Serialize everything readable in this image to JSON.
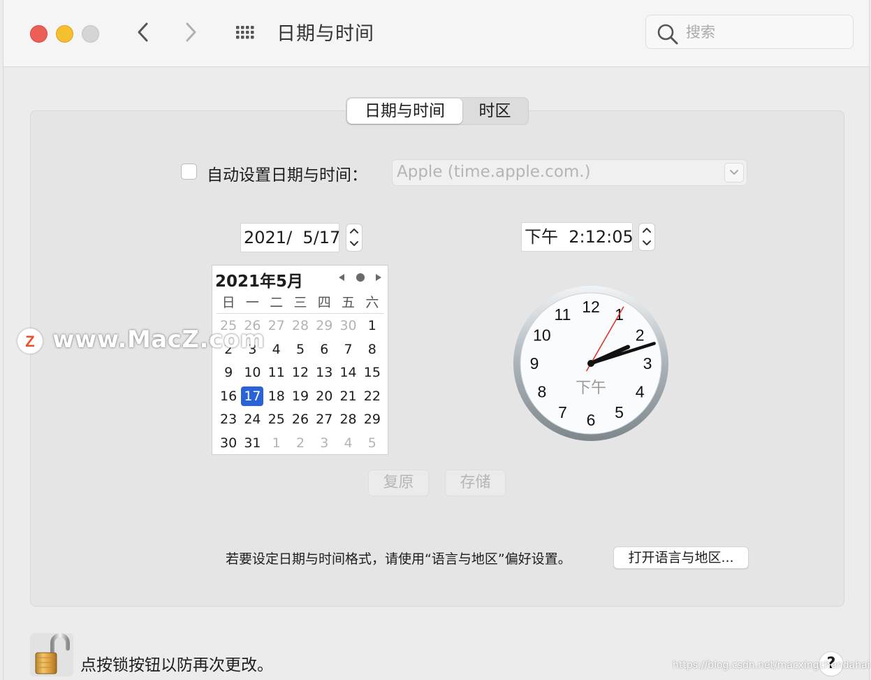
{
  "window": {
    "title": "日期与时间"
  },
  "search": {
    "placeholder": "搜索"
  },
  "tabs": [
    {
      "label": "日期与时间",
      "active": true
    },
    {
      "label": "时区",
      "active": false
    }
  ],
  "auto": {
    "checked": false,
    "label": "自动设置日期与时间：",
    "server": "Apple (time.apple.com.)"
  },
  "date_field": "2021/  5/17",
  "time_field": "下午  2:12:05",
  "calendar": {
    "title": "2021年5月",
    "weekdays": [
      "日",
      "一",
      "二",
      "三",
      "四",
      "五",
      "六"
    ],
    "selected": "17",
    "rows": [
      [
        {
          "d": "25",
          "m": true
        },
        {
          "d": "26",
          "m": true
        },
        {
          "d": "27",
          "m": true
        },
        {
          "d": "28",
          "m": true
        },
        {
          "d": "29",
          "m": true
        },
        {
          "d": "30",
          "m": true
        },
        {
          "d": "1",
          "m": false
        }
      ],
      [
        {
          "d": "2",
          "m": false
        },
        {
          "d": "3",
          "m": false
        },
        {
          "d": "4",
          "m": false
        },
        {
          "d": "5",
          "m": false
        },
        {
          "d": "6",
          "m": false
        },
        {
          "d": "7",
          "m": false
        },
        {
          "d": "8",
          "m": false
        }
      ],
      [
        {
          "d": "9",
          "m": false
        },
        {
          "d": "10",
          "m": false
        },
        {
          "d": "11",
          "m": false
        },
        {
          "d": "12",
          "m": false
        },
        {
          "d": "13",
          "m": false
        },
        {
          "d": "14",
          "m": false
        },
        {
          "d": "15",
          "m": false
        }
      ],
      [
        {
          "d": "16",
          "m": false
        },
        {
          "d": "17",
          "m": false
        },
        {
          "d": "18",
          "m": false
        },
        {
          "d": "19",
          "m": false
        },
        {
          "d": "20",
          "m": false
        },
        {
          "d": "21",
          "m": false
        },
        {
          "d": "22",
          "m": false
        }
      ],
      [
        {
          "d": "23",
          "m": false
        },
        {
          "d": "24",
          "m": false
        },
        {
          "d": "25",
          "m": false
        },
        {
          "d": "26",
          "m": false
        },
        {
          "d": "27",
          "m": false
        },
        {
          "d": "28",
          "m": false
        },
        {
          "d": "29",
          "m": false
        }
      ],
      [
        {
          "d": "30",
          "m": false
        },
        {
          "d": "31",
          "m": false
        },
        {
          "d": "1",
          "m": true
        },
        {
          "d": "2",
          "m": true
        },
        {
          "d": "3",
          "m": true
        },
        {
          "d": "4",
          "m": true
        },
        {
          "d": "5",
          "m": true
        }
      ]
    ]
  },
  "clock": {
    "numbers": [
      "12",
      "1",
      "2",
      "3",
      "4",
      "5",
      "6",
      "7",
      "8",
      "9",
      "10",
      "11"
    ],
    "ampm": "下午",
    "hour": 2,
    "minute": 12,
    "second": 5
  },
  "buttons": {
    "revert": "复原",
    "save": "存储",
    "open_language": "打开语言与地区..."
  },
  "hint": "若要设定日期与时间格式，请使用“语言与地区”偏好设置。",
  "lock": {
    "label": "点按锁按钮以防再次更改。"
  },
  "help": {
    "label": "?"
  },
  "watermark": {
    "text": "www.MacZ.com",
    "logo_letter": "Z",
    "url": "https://blog.csdn.net/macxingchendahai"
  },
  "colors": {
    "accent": "#2a62d8",
    "close": "#ec5f57",
    "minimize": "#f5bf2f",
    "zoom_disabled": "#d5d5d5",
    "second_hand": "#e0332a"
  },
  "icons": [
    "back-chevron-icon",
    "forward-chevron-icon",
    "grid-icon",
    "search-icon",
    "chevron-down-icon",
    "lock-icon"
  ]
}
